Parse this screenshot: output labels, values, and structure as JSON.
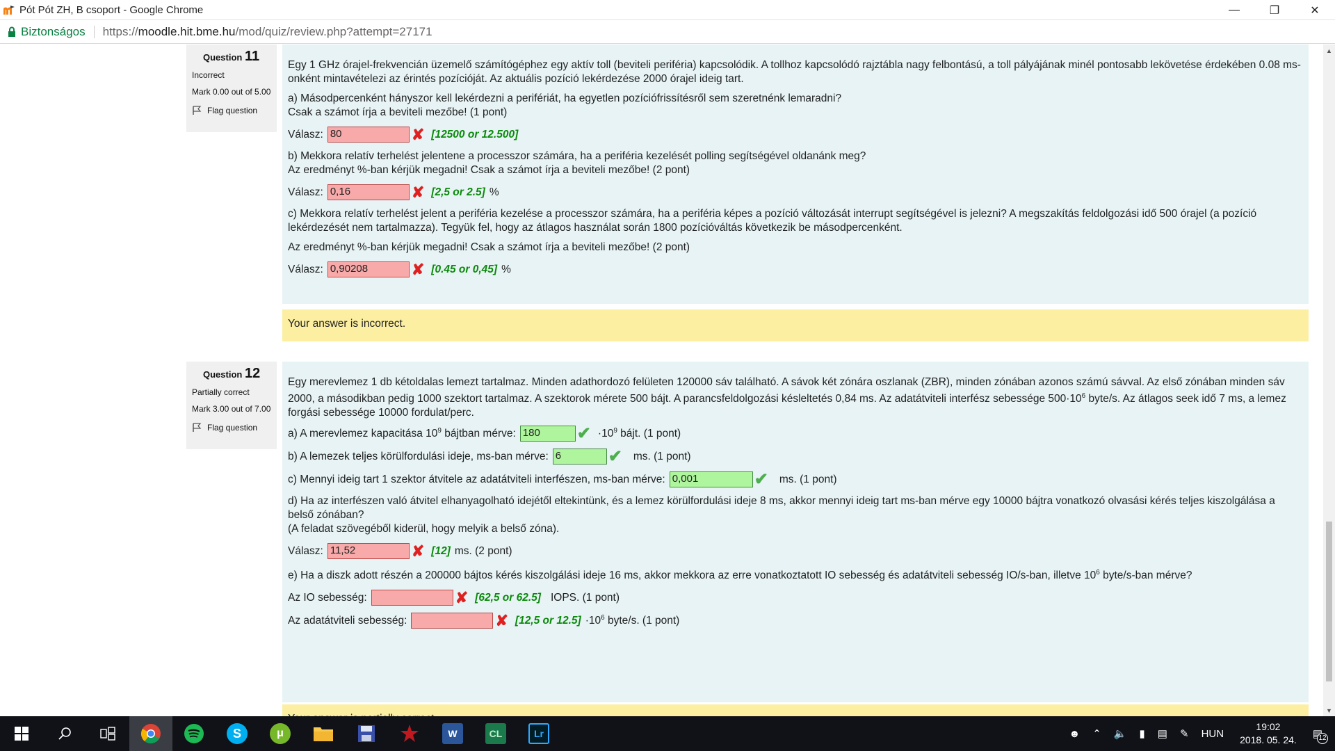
{
  "window": {
    "title": "Pót Pót ZH, B csoport - Google Chrome",
    "minimize_icon": "minimize-icon",
    "maximize_icon": "restore-icon",
    "close_icon": "close-icon"
  },
  "addressbar": {
    "secure_label": "Biztonságos",
    "url_scheme": "https://",
    "url_host": "moodle.hit.bme.hu",
    "url_path": "/mod/quiz/review.php?attempt=27171"
  },
  "q11": {
    "label": "Question",
    "number": "11",
    "state": "Incorrect",
    "grade": "Mark 0.00 out of 5.00",
    "flag": "Flag question",
    "text": "Egy 1 GHz órajel-frekvencián üzemelő számítógéphez egy aktív toll (beviteli periféria) kapcsolódik. A tollhoz kapcsolódó rajztábla nagy felbontású, a toll pályájának minél pontosabb lekövetése érdekében 0.08 ms-onként mintavételezi az érintés pozícióját. Az aktuális pozíció lekérdezése 2000 órajel ideig tart.",
    "a_text1": "a) Másodpercenként hányszor kell lekérdezni a perifériát, ha egyetlen pozíciófrissítésről sem szeretnénk lemaradni?",
    "a_text2": "Csak a számot írja a beviteli mezőbe! (1 pont)",
    "a_label": "Válasz:",
    "a_value": "80",
    "a_correct": "[12500 or 12.500]",
    "b_text1": "b) Mekkora relatív terhelést jelentene a processzor számára, ha a periféria kezelését polling segítségével oldanánk meg?",
    "b_text2": "Az eredményt %-ban kérjük megadni! Csak a számot írja a beviteli mezőbe! (2 pont)",
    "b_label": "Válasz:",
    "b_value": "0,16",
    "b_correct": "[2,5 or 2.5]",
    "b_unit": "%",
    "c_text1": "c) Mekkora relatív terhelést jelent a periféria kezelése a processzor számára, ha a periféria képes a pozíció változását interrupt segítségével is jelezni? A megszakítás feldolgozási idő 500 órajel (a pozíció lekérdezését nem tartalmazza). Tegyük fel, hogy az átlagos használat során 1800 pozícióváltás következik be másodpercenként.",
    "c_text2": "Az eredményt %-ban kérjük megadni! Csak a számot írja a beviteli mezőbe! (2 pont)",
    "c_label": "Válasz:",
    "c_value": "0,90208",
    "c_correct": "[0.45 or 0,45]",
    "c_unit": "%",
    "feedback": "Your answer is incorrect."
  },
  "q12": {
    "label": "Question",
    "number": "12",
    "state": "Partially correct",
    "grade": "Mark 3.00 out of 7.00",
    "flag": "Flag question",
    "text_1": "Egy merevlemez 1 db kétoldalas lemezt tartalmaz. Minden adathordozó felületen 120000 sáv található. A sávok két zónára oszlanak (ZBR), minden zónában azonos számú sávval. Az első zónában minden sáv 2000, a másodikban pedig 1000 szektort tartalmaz. A szektorok mérete 500 bájt. A parancsfeldolgozási késleltetés 0,84 ms. Az adatátviteli interfész sebessége 500·10",
    "text_sup": "6",
    "text_2": " byte/s. Az átlagos seek idő 7 ms, a lemez forgási sebessége 10000 fordulat/perc.",
    "a_pre": "a) A merevlemez kapacitása 10",
    "a_sup": "9",
    "a_pre2": " bájtban mérve:",
    "a_value": "180",
    "a_post_pre": "·10",
    "a_post_sup": "9",
    "a_post": " bájt. (1 pont)",
    "b_pre": "b) A lemezek teljes körülfordulási ideje, ms-ban mérve:",
    "b_value": "6",
    "b_post": "ms. (1 pont)",
    "c_pre": "c) Mennyi ideig tart 1 szektor átvitele az adatátviteli interfészen, ms-ban mérve:",
    "c_value": "0,001",
    "c_post": "ms. (1 pont)",
    "d_text1": "d) Ha az interfészen való átvitel elhanyagolható idejétől eltekintünk, és a lemez körülfordulási ideje 8 ms, akkor mennyi ideig tart ms-ban mérve egy 10000 bájtra vonatkozó olvasási kérés teljes kiszolgálása a belső zónában?",
    "d_text2": "(A feladat szövegéből kiderül, hogy melyik a belső zóna).",
    "d_label": "Válasz:",
    "d_value": "11,52",
    "d_correct": "[12]",
    "d_post": "ms. (2 pont)",
    "e_text": "e) Ha a diszk adott részén a 200000 bájtos kérés kiszolgálási ideje  16 ms, akkor mekkora az erre vonatkoztatott IO sebesség és adatátviteli sebesség IO/s-ban, illetve 10",
    "e_sup": "6",
    "e_text2": " byte/s-ban mérve?",
    "e1_label": "Az IO sebesség:",
    "e1_value": "",
    "e1_correct": "[62,5 or 62.5]",
    "e1_post": "IOPS. (1 pont)",
    "e2_label": "Az adatátviteli sebesség:",
    "e2_value": "",
    "e2_correct": "[12,5 or 12.5]",
    "e2_post_pre": "·10",
    "e2_post_sup": "6",
    "e2_post": " byte/s. (1 pont)",
    "feedback": "Your answer is partially correct."
  },
  "taskbar": {
    "apps": [
      "start-icon",
      "search-icon",
      "task-view-icon",
      "chrome-icon",
      "spotify-icon",
      "skype-icon",
      "utorrent-icon",
      "file-explorer-icon",
      "save-icon",
      "app-icon",
      "word-icon",
      "cl-icon",
      "lightroom-icon"
    ],
    "word_label": "W",
    "cl_label": "CL",
    "lr_label": "Lr",
    "lang": "HUN",
    "time": "19:02",
    "date": "2018. 05. 24.",
    "notifications": "12"
  }
}
